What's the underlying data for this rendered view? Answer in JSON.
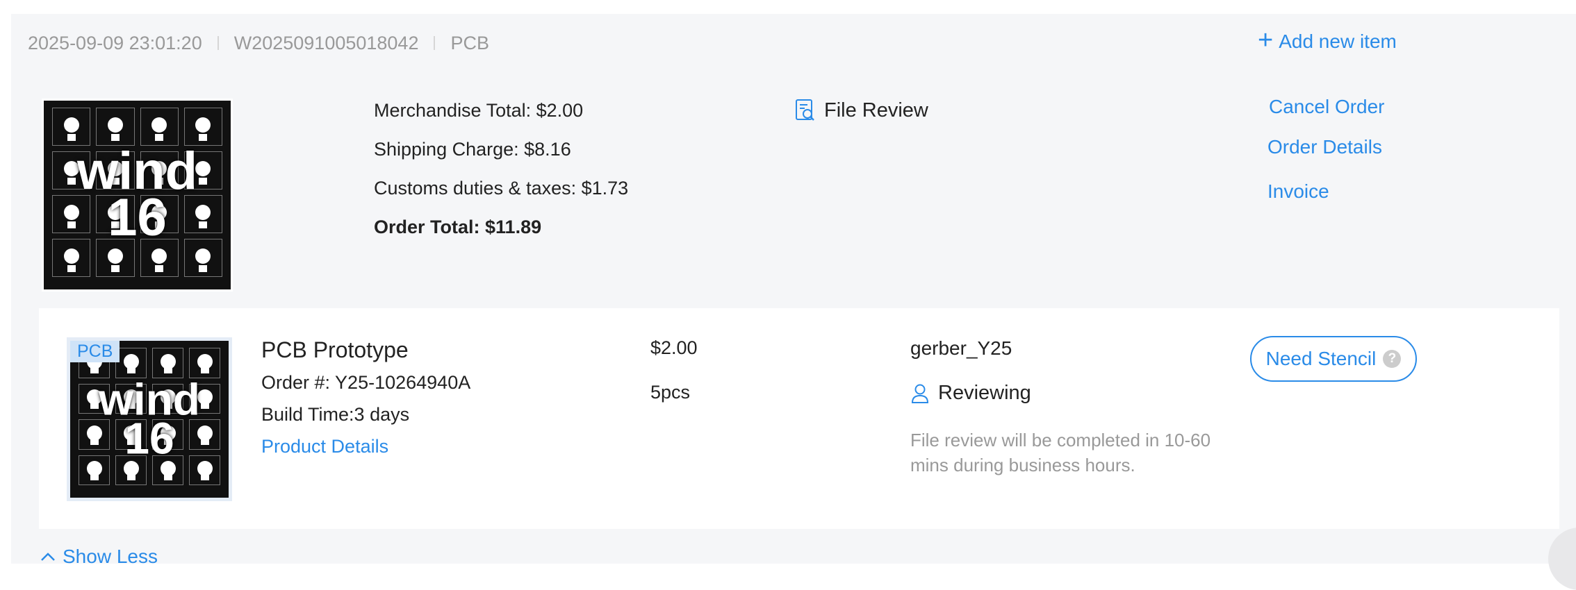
{
  "order": {
    "datetime": "2025-09-09 23:01:20",
    "order_number": "W2025091005018042",
    "product_type": "PCB",
    "add_new_item_label": "Add new item",
    "thumbnail_text": "wind\n16",
    "totals": {
      "merchandise": "Merchandise Total: $2.00",
      "shipping": "Shipping Charge: $8.16",
      "customs": "Customs duties & taxes: $1.73",
      "grand_total": "Order Total: $11.89"
    },
    "file_review_label": "File Review",
    "actions": {
      "cancel": "Cancel Order",
      "details": "Order Details",
      "invoice": "Invoice"
    }
  },
  "item": {
    "tag": "PCB",
    "title": "PCB Prototype",
    "order_no": "Order #: Y25-10264940A",
    "build_time": "Build Time:3 days",
    "product_details_link": "Product Details",
    "price": "$2.00",
    "quantity": "5pcs",
    "file_name": "gerber_Y25",
    "status": "Reviewing",
    "status_note": "File review will be completed in 10-60 mins during business hours.",
    "need_stencil_label": "Need Stencil",
    "help_glyph": "?"
  },
  "footer": {
    "show_less_label": "Show Less"
  },
  "colors": {
    "accent": "#2a8be8",
    "muted_text": "#999999",
    "card_bg": "#f5f6f8"
  },
  "icons": [
    "plus-icon",
    "file-review-icon",
    "reviewer-icon",
    "help-icon",
    "chevron-up-icon"
  ]
}
